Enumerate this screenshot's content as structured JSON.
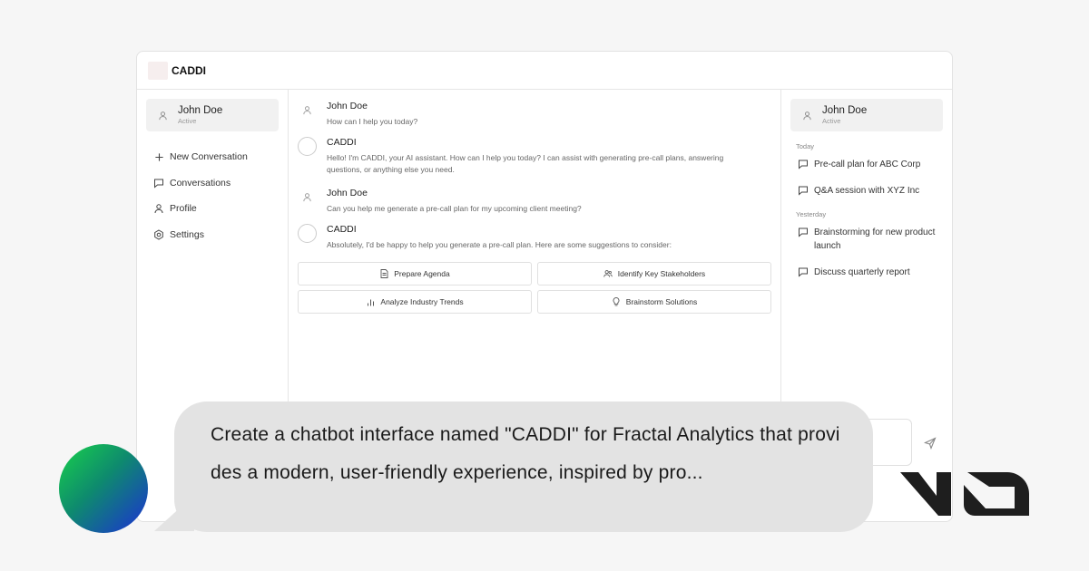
{
  "app": {
    "brand": "CADDI"
  },
  "left": {
    "user": {
      "name": "John Doe",
      "status": "Active"
    },
    "nav": [
      {
        "label": "New Conversation",
        "icon": "plus-icon"
      },
      {
        "label": "Conversations",
        "icon": "chat-bubble-icon"
      },
      {
        "label": "Profile",
        "icon": "user-icon"
      },
      {
        "label": "Settings",
        "icon": "gear-icon"
      }
    ]
  },
  "chat": {
    "messages": [
      {
        "who": "John Doe",
        "text": "How can I help you today?"
      },
      {
        "who": "CADDI",
        "text": "Hello! I'm CADDI, your AI assistant. How can I help you today? I can assist with generating pre-call plans, answering questions, or anything else you need."
      },
      {
        "who": "John Doe",
        "text": "Can you help me generate a pre-call plan for my upcoming client meeting?"
      },
      {
        "who": "CADDI",
        "text": "Absolutely, I'd be happy to help you generate a pre-call plan. Here are some suggestions to consider:"
      }
    ],
    "suggestions": [
      {
        "label": "Prepare Agenda",
        "icon": "document-icon"
      },
      {
        "label": "Identify Key Stakeholders",
        "icon": "users-icon"
      },
      {
        "label": "Analyze Industry Trends",
        "icon": "bar-chart-icon"
      },
      {
        "label": "Brainstorm Solutions",
        "icon": "lightbulb-icon"
      }
    ]
  },
  "right": {
    "user": {
      "name": "John Doe",
      "status": "Active"
    },
    "today_label": "Today",
    "today": [
      "Pre-call plan for ABC Corp",
      "Q&A session with XYZ Inc"
    ],
    "yesterday_label": "Yesterday",
    "yesterday": [
      "Brainstorming for new product launch",
      "Discuss quarterly report"
    ]
  },
  "overlay": {
    "prompt": "Create a chatbot interface named \"CADDI\" for Fractal Analytics that provides a modern, user-friendly experience, inspired by pro..."
  },
  "colors": {
    "accent_green": "#18d24a",
    "accent_blue": "#1c2fd6",
    "bubble": "#e3e3e3"
  }
}
